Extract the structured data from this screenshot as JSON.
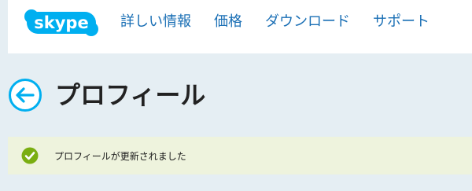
{
  "header": {
    "logo_text": "skype",
    "logo_icon": "skype-logo",
    "nav": [
      {
        "label": "詳しい情報"
      },
      {
        "label": "価格"
      },
      {
        "label": "ダウンロード"
      },
      {
        "label": "サポート"
      }
    ]
  },
  "page": {
    "title": "プロフィール",
    "back_icon": "back-arrow-icon"
  },
  "notice": {
    "message": "プロフィールが更新されました",
    "icon": "check-circle-icon"
  },
  "colors": {
    "brand_blue": "#00aff0",
    "nav_link": "#1a6fb5",
    "page_background": "#e5eef3",
    "notice_background": "#eef3dd",
    "success_green": "#7aae11"
  }
}
